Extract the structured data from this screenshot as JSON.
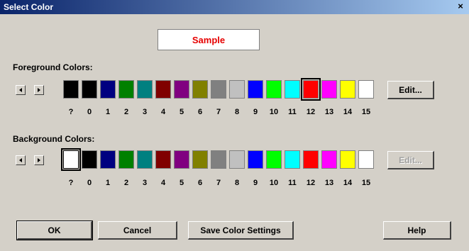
{
  "window": {
    "title": "Select Color",
    "close_symbol": "×"
  },
  "sample": {
    "text": "Sample",
    "color": "#e60000"
  },
  "foreground": {
    "label": "Foreground Colors:",
    "edit_label": "Edit...",
    "selected": "12"
  },
  "background": {
    "label": "Background Colors:",
    "edit_label": "Edit...",
    "selected": "?"
  },
  "swatches": [
    {
      "label": "?",
      "color": "#000000"
    },
    {
      "label": "0",
      "color": "#000000"
    },
    {
      "label": "1",
      "color": "#000080"
    },
    {
      "label": "2",
      "color": "#008000"
    },
    {
      "label": "3",
      "color": "#008080"
    },
    {
      "label": "4",
      "color": "#800000"
    },
    {
      "label": "5",
      "color": "#800080"
    },
    {
      "label": "6",
      "color": "#808000"
    },
    {
      "label": "7",
      "color": "#808080"
    },
    {
      "label": "8",
      "color": "#c0c0c0"
    },
    {
      "label": "9",
      "color": "#0000ff"
    },
    {
      "label": "10",
      "color": "#00ff00"
    },
    {
      "label": "11",
      "color": "#00ffff"
    },
    {
      "label": "12",
      "color": "#ff0000"
    },
    {
      "label": "13",
      "color": "#ff00ff"
    },
    {
      "label": "14",
      "color": "#ffff00"
    },
    {
      "label": "15",
      "color": "#ffffff"
    }
  ],
  "buttons": {
    "ok": "OK",
    "cancel": "Cancel",
    "save": "Save Color Settings",
    "help": "Help"
  },
  "icons": {
    "scroll_left": "left-arrow-icon",
    "scroll_right": "right-arrow-icon"
  }
}
